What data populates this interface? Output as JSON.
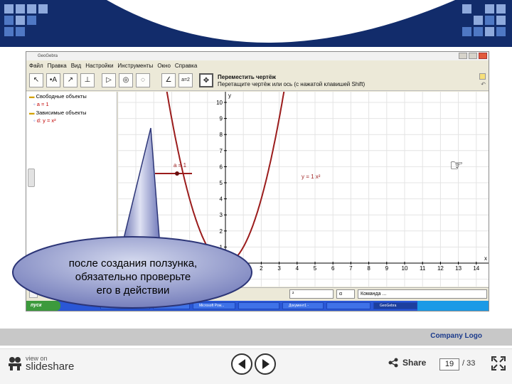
{
  "window": {
    "title": "GeoGebra",
    "menu": [
      "Файл",
      "Правка",
      "Вид",
      "Настройки",
      "Инструменты",
      "Окно",
      "Справка"
    ]
  },
  "toolbar": {
    "tools": [
      "↖",
      "•A",
      "↗",
      "⊥",
      "▷",
      "◎",
      "◌",
      "∠",
      "a=2",
      "✥"
    ],
    "hint_title": "Переместить чертёж",
    "hint_text": "Перетащите чертёж или ось (с нажатой клавишей Shift)"
  },
  "algebra": {
    "free_header": "Свободные объекты",
    "free_obj": "a = 1",
    "dep_header": "Зависимые объекты",
    "dep_obj": "d: y = x²"
  },
  "graph": {
    "slider_label": "a = 1",
    "curve_label": "y = 1 x²",
    "y_axis_label": "y",
    "x_axis_label": "x",
    "x_ticks": [
      "1",
      "2",
      "3",
      "4",
      "5",
      "6",
      "7",
      "8",
      "9",
      "10",
      "11",
      "12",
      "13",
      "14"
    ],
    "y_ticks": [
      "1",
      "2",
      "3",
      "4",
      "5",
      "6",
      "7",
      "8",
      "9",
      "10"
    ]
  },
  "input_bar": {
    "combo1": "²",
    "combo2": "α",
    "command": "Команда ..."
  },
  "taskbar": {
    "start": "пуск",
    "tasks": [
      "",
      "",
      "Microsoft Pow...",
      "",
      "Документ1 -",
      "",
      "GeoGebra"
    ]
  },
  "callout": {
    "line1": "после создания ползунка,",
    "line2": "обязательно проверьте",
    "line3": "его в действии"
  },
  "footer": {
    "company": "Company  Logo"
  },
  "slideshare": {
    "view_on": "view on",
    "name": "slideshare",
    "share": "Share",
    "page": "19",
    "total": "/ 33"
  }
}
